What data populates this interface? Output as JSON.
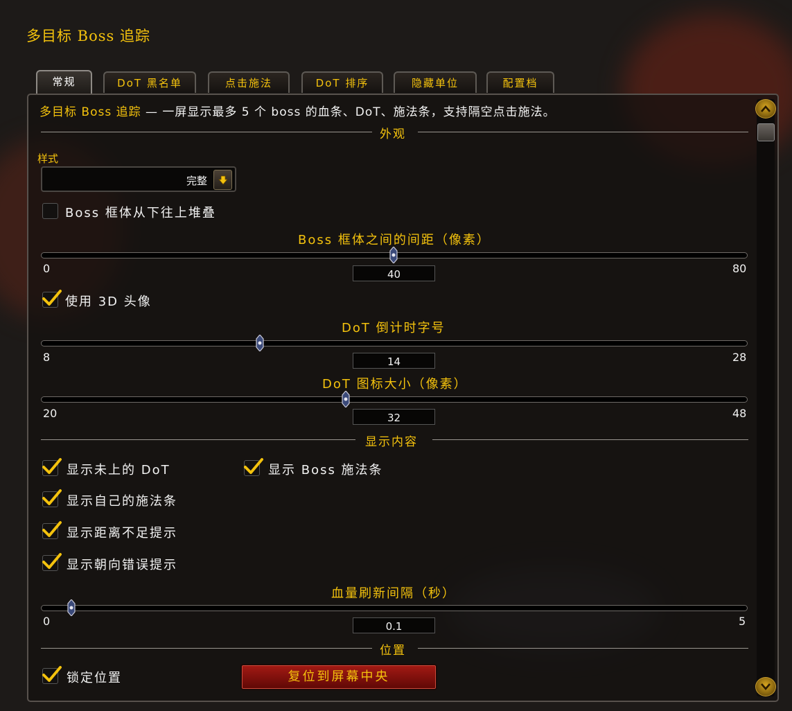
{
  "window": {
    "title": "多目标 Boss 追踪"
  },
  "tabs": [
    {
      "label": "常规",
      "active": true
    },
    {
      "label": "DoT 黑名单"
    },
    {
      "label": "点击施法"
    },
    {
      "label": "DoT 排序"
    },
    {
      "label": "隐藏单位"
    },
    {
      "label": "配置档"
    }
  ],
  "description": {
    "highlight": "多目标 Boss 追踪",
    "rest": " — 一屏显示最多 5 个 boss 的血条、DoT、施法条，支持隔空点击施法。"
  },
  "sections": {
    "appearance": "外观",
    "display": "显示内容",
    "position": "位置"
  },
  "style": {
    "label": "样式",
    "value": "完整"
  },
  "checkboxes": {
    "stack_bottom_up": {
      "label": "Boss 框体从下往上堆叠",
      "checked": false
    },
    "use_3d_portrait": {
      "label": "使用 3D 头像",
      "checked": true
    },
    "show_missing_dot": {
      "label": "显示未上的 DoT",
      "checked": true
    },
    "show_boss_cast": {
      "label": "显示 Boss 施法条",
      "checked": true
    },
    "show_own_cast": {
      "label": "显示自己的施法条",
      "checked": true
    },
    "show_range_warn": {
      "label": "显示距离不足提示",
      "checked": true
    },
    "show_facing_warn": {
      "label": "显示朝向错误提示",
      "checked": true
    },
    "lock_position": {
      "label": "锁定位置",
      "checked": true
    }
  },
  "sliders": {
    "spacing": {
      "title": "Boss 框体之间的间距（像素）",
      "min": "0",
      "max": "80",
      "value": "40",
      "fraction": 0.5
    },
    "dot_font": {
      "title": "DoT 倒计时字号",
      "min": "8",
      "max": "28",
      "value": "14",
      "fraction": 0.3
    },
    "dot_icon": {
      "title": "DoT 图标大小（像素）",
      "min": "20",
      "max": "48",
      "value": "32",
      "fraction": 0.43
    },
    "hp_interval": {
      "title": "血量刷新间隔（秒）",
      "min": "0",
      "max": "5",
      "value": "0.1",
      "fraction": 0.02
    }
  },
  "buttons": {
    "reset_center": "复位到屏幕中央"
  },
  "colors": {
    "accent": "#f4c20d",
    "text": "#f2f2f2",
    "button_red": "#a41a14"
  }
}
